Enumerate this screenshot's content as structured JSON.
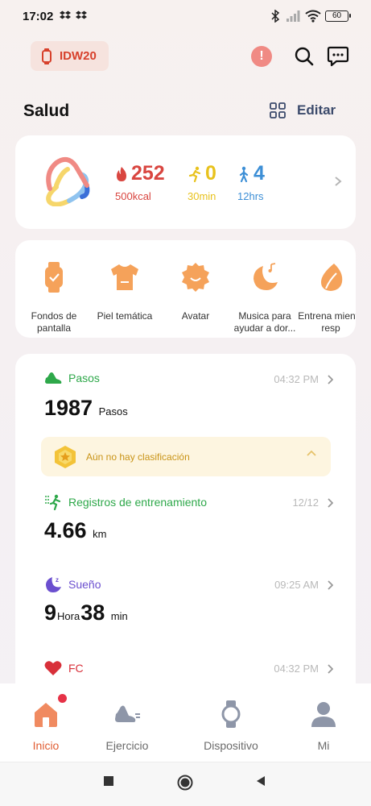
{
  "status_bar": {
    "time": "17:02",
    "battery": "60"
  },
  "header": {
    "device_name": "IDW20"
  },
  "section": {
    "title": "Salud",
    "edit_label": "Editar"
  },
  "summary": {
    "calories": {
      "value": "252",
      "goal": "500kcal",
      "color": "#d94640"
    },
    "exercise": {
      "value": "0",
      "goal": "30min",
      "color": "#e8c21d"
    },
    "standing": {
      "value": "4",
      "goal": "12hrs",
      "color": "#3d8fd6"
    }
  },
  "shortcuts": [
    {
      "label": "Fondos de pantalla",
      "icon": "watch-icon"
    },
    {
      "label": "Piel temática",
      "icon": "shirt-icon"
    },
    {
      "label": "Avatar",
      "icon": "avatar-icon"
    },
    {
      "label": "Musica para ayudar a dor...",
      "icon": "moon-music-icon"
    },
    {
      "label": "Entrena miento resp",
      "icon": "leaf-icon"
    }
  ],
  "health": {
    "steps": {
      "title": "Pasos",
      "time": "04:32 PM",
      "value": "1987",
      "unit": "Pasos",
      "color": "#2ea84a"
    },
    "ranking": {
      "text": "Aún no hay clasificación"
    },
    "training": {
      "title": "Registros de entrenamiento",
      "time": "12/12",
      "value": "4.66",
      "unit": "km",
      "color": "#2ea84a"
    },
    "sleep": {
      "title": "Sueño",
      "time": "09:25 AM",
      "hours": "9",
      "hours_unit": "Hora",
      "minutes": "38",
      "minutes_unit": "min",
      "color": "#6b4fcf"
    },
    "heart": {
      "title": "FC",
      "time": "04:32 PM",
      "color": "#d8303a"
    }
  },
  "bottom_nav": [
    {
      "label": "Inicio",
      "active": true
    },
    {
      "label": "Ejercicio",
      "active": false
    },
    {
      "label": "Dispositivo",
      "active": false
    },
    {
      "label": "Mi",
      "active": false
    }
  ],
  "colors": {
    "accent": "#e05c31",
    "orange": "#f5a25a"
  }
}
